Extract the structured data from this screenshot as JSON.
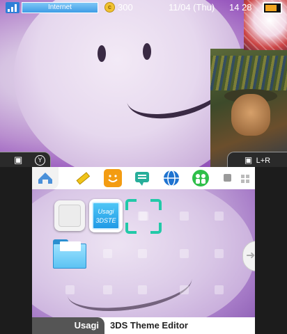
{
  "status": {
    "network": "Internet",
    "coins": "300",
    "coin_symbol": "c",
    "date": "11/04 (Thu)",
    "time": "14 28",
    "battery_color": "#f3a521"
  },
  "shoulder": {
    "left_label": "Y",
    "right_label": "L+R"
  },
  "toolbar": {
    "icons": [
      "settings-icon",
      "pencil-icon",
      "face-icon",
      "message-icon",
      "globe-icon",
      "people-icon"
    ]
  },
  "grid": {
    "app_label": "Usagi\n3DSTE"
  },
  "footer": {
    "user": "Usagi",
    "title": "3DS Theme Editor"
  },
  "colors": {
    "accent": "#22c9a8",
    "blue": "#2f7fd8",
    "toolbar": "#ffffff"
  }
}
